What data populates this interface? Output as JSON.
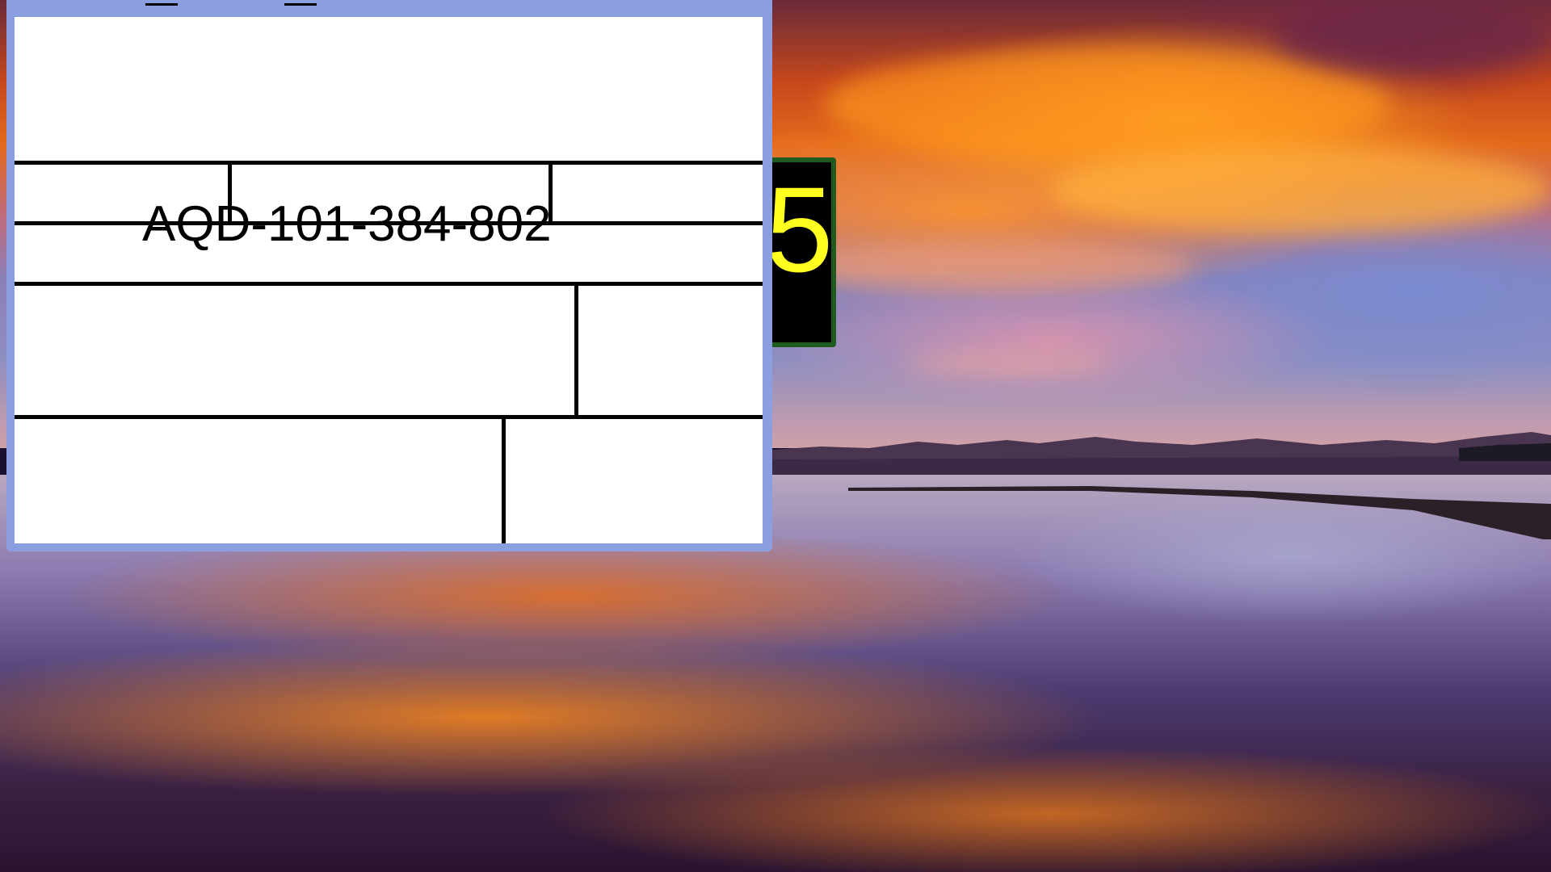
{
  "desktop": {
    "wallpaper": "sunset-lake-landscape"
  },
  "widget": {
    "digit": "5",
    "digit_color": "#ffff20",
    "frame_color": "#1f5a1f",
    "background": "#000000"
  },
  "window": {
    "frame_color": "#8b9fe0",
    "title_controls": [
      "minimize-icon",
      "minimize-icon"
    ],
    "form": {
      "code": "AQD-101-384-802"
    }
  }
}
